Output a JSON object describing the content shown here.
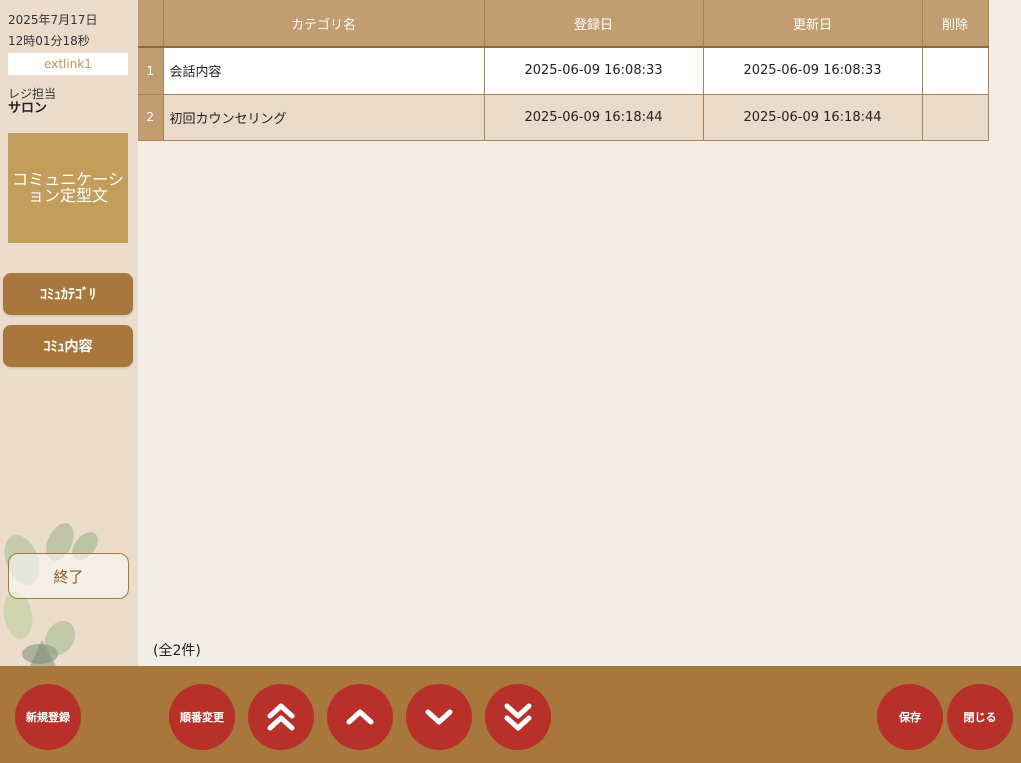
{
  "sidebar": {
    "date": "2025年7月17日",
    "time": "12時01分18秒",
    "user": "extlink1",
    "staff_label": "レジ担当",
    "staff_name": "サロン",
    "tile": "コミュニケーション定型文",
    "nav": [
      {
        "label": "ｺﾐｭｶﾃｺﾞﾘ"
      },
      {
        "label": "ｺﾐｭ内容"
      }
    ],
    "exit_label": "終了"
  },
  "table": {
    "headers": {
      "name": "カテゴリ名",
      "created": "登録日",
      "updated": "更新日",
      "delete": "削除"
    },
    "rows": [
      {
        "no": "1",
        "name": "会話内容",
        "created": "2025-06-09 16:08:33",
        "updated": "2025-06-09 16:08:33"
      },
      {
        "no": "2",
        "name": "初回カウンセリング",
        "created": "2025-06-09 16:18:44",
        "updated": "2025-06-09 16:18:44"
      }
    ]
  },
  "count": "(全2件)",
  "toolbar": {
    "new_label": "新規登録",
    "reorder_label": "順番変更",
    "top_icon": "double-chevron-up-icon",
    "up_icon": "chevron-up-icon",
    "down_icon": "chevron-down-icon",
    "bottom_icon": "double-chevron-down-icon",
    "save_label": "保存",
    "close_label": "閉じる"
  },
  "colors": {
    "accent": "#a8773c",
    "header": "#c29d72",
    "button_red": "#b8302a",
    "background": "#f3ede7",
    "sidebar": "#ecdccb"
  }
}
